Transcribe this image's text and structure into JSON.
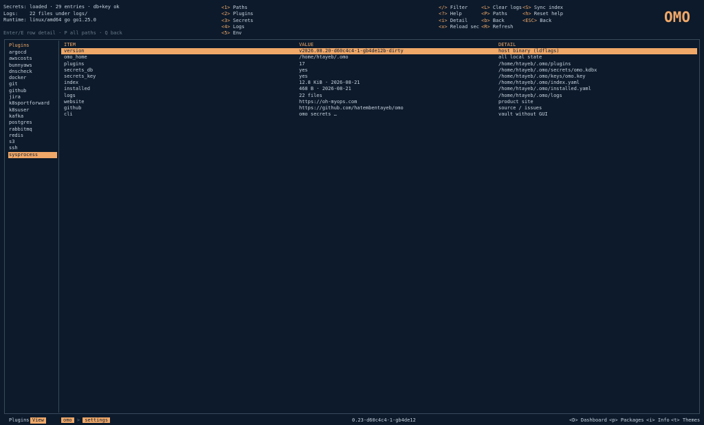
{
  "header": {
    "status": [
      {
        "key": "Secrets:",
        "value": "loaded · 29 entries · db+key ok"
      },
      {
        "key": "Logs:",
        "value": "22 files under logs/"
      },
      {
        "key": "Runtime:",
        "value": "linux/amd64  go go1.25.0"
      }
    ],
    "hint": "Enter/E row detail · P all paths · Q back",
    "nav_sections": [
      {
        "key": "<1>",
        "label": "Paths"
      },
      {
        "key": "<2>",
        "label": "Plugins"
      },
      {
        "key": "<3>",
        "label": "Secrets"
      },
      {
        "key": "<4>",
        "label": "Logs"
      },
      {
        "key": "<5>",
        "label": "Env"
      }
    ],
    "actions_a": [
      {
        "key": "</>",
        "label": "Filter"
      },
      {
        "key": "<?>",
        "label": "Help"
      },
      {
        "key": "<i>",
        "label": "Detail"
      },
      {
        "key": "<x>",
        "label": "Reload sec"
      }
    ],
    "actions_b": [
      {
        "key": "<L>",
        "label": "Clear logs"
      },
      {
        "key": "<P>",
        "label": "Paths"
      },
      {
        "key": "<b>",
        "label": "Back"
      },
      {
        "key": "<R>",
        "label": "Refresh"
      }
    ],
    "actions_c": [
      {
        "key": "<S>",
        "label": "Sync index"
      },
      {
        "key": "<h>",
        "label": "Reset help"
      },
      {
        "key": "<ESC>",
        "label": "Back"
      }
    ],
    "logo_text": "OMO"
  },
  "sidebar": {
    "title": "Plugins",
    "items": [
      "argocd",
      "awscosts",
      "bunnyaws",
      "dnscheck",
      "docker",
      "git",
      "github",
      "jira",
      "k8sportforward",
      "k8suser",
      "kafka",
      "postgres",
      "rabbitmq",
      "redis",
      "s3",
      "ssh",
      "sysprocess"
    ],
    "selected": "sysprocess"
  },
  "table": {
    "columns": [
      "ITEM",
      "VALUE",
      "DETAIL"
    ],
    "selected_index": 0,
    "rows": [
      [
        "version",
        "v2026.08.20-d60c4c4-1-gb4de12b-dirty",
        "host binary (ldflags)"
      ],
      [
        "omo_home",
        "/home/htayeb/.omo",
        "all local state"
      ],
      [
        "plugins",
        "17",
        "/home/htayeb/.omo/plugins"
      ],
      [
        "secrets_db",
        "yes",
        "/home/htayeb/.omo/secrets/omo.kdbx"
      ],
      [
        "secrets_key",
        "yes",
        "/home/htayeb/.omo/keys/omo.key"
      ],
      [
        "index",
        "12.8 KiB · 2026-08-21",
        "/home/htayeb/.omo/index.yaml"
      ],
      [
        "installed",
        "468 B · 2026-08-21",
        "/home/htayeb/.omo/installed.yaml"
      ],
      [
        "logs",
        "22 files",
        "/home/htayeb/.omo/logs"
      ],
      [
        "website",
        "https://oh-myops.com",
        "product site"
      ],
      [
        "github",
        "https://github.com/hatembentayeb/omo",
        "source / issues"
      ],
      [
        "cli",
        "omo secrets …",
        "vault without GUI"
      ]
    ]
  },
  "statusbar": {
    "left_label": "Plugins",
    "mode": "View",
    "crumb_root": "omo",
    "crumb_sep": ">",
    "crumb_current": "settings",
    "version": "0.23-d60c4c4-1-gb4de12",
    "shortcuts": [
      {
        "key": "<D>",
        "label": "Dashboard"
      },
      {
        "key": "<p>",
        "label": "Packages"
      },
      {
        "key": "<i>",
        "label": "Info"
      },
      {
        "key": "<t>",
        "label": "Themes"
      }
    ]
  },
  "colors": {
    "accent": "#f0a868",
    "background": "#0c1a2b",
    "text": "#c9d3de"
  }
}
